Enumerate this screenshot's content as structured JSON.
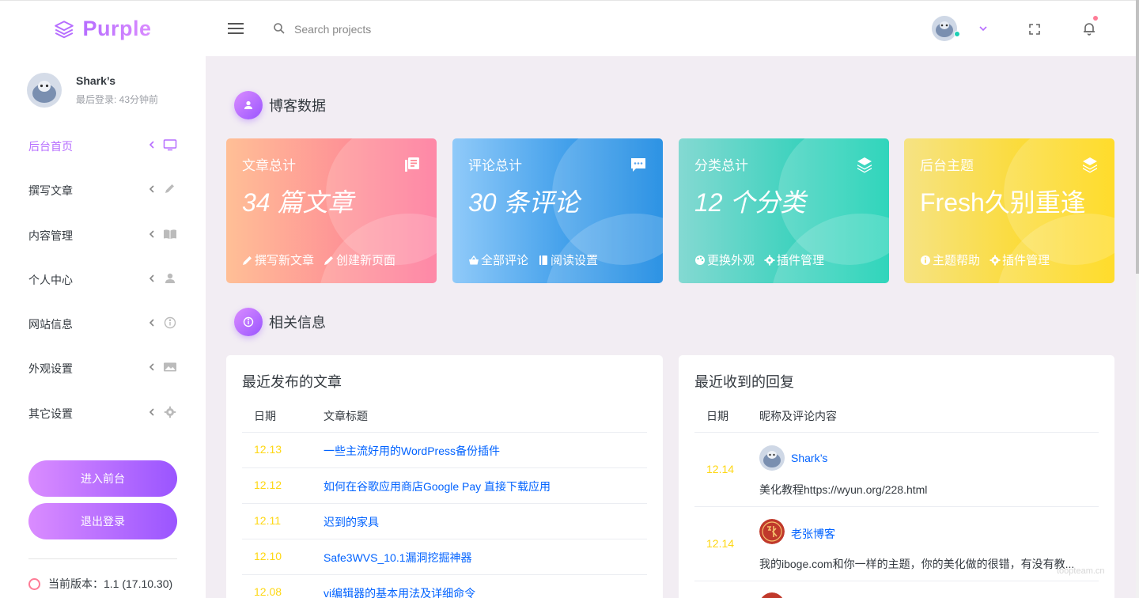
{
  "brand": {
    "name": "Purple"
  },
  "search": {
    "placeholder": "Search projects"
  },
  "profile": {
    "name": "Shark’s",
    "last_login": "最后登录: 43分钟前"
  },
  "nav": [
    {
      "label": "后台首页",
      "icon": "monitor-icon",
      "active": true
    },
    {
      "label": "撰写文章",
      "icon": "pencil-icon",
      "active": false
    },
    {
      "label": "内容管理",
      "icon": "book-open-icon",
      "active": false
    },
    {
      "label": "个人中心",
      "icon": "user-icon",
      "active": false
    },
    {
      "label": "网站信息",
      "icon": "info-icon",
      "active": false
    },
    {
      "label": "外观设置",
      "icon": "image-icon",
      "active": false
    },
    {
      "label": "其它设置",
      "icon": "gear-icon",
      "active": false
    }
  ],
  "buttons": {
    "front": "进入前台",
    "logout": "退出登录"
  },
  "version": "当前版本：1.1 (17.10.30)",
  "sections": {
    "blog_data": "博客数据",
    "related_info": "相关信息"
  },
  "cards": [
    {
      "title": "文章总计",
      "value": "34 篇文章",
      "icon": "library-icon",
      "links": [
        {
          "label": "撰写新文章",
          "icon": "pencil-icon"
        },
        {
          "label": "创建新页面",
          "icon": "pencil-icon"
        }
      ]
    },
    {
      "title": "评论总计",
      "value": "30 条评论",
      "icon": "message-icon",
      "links": [
        {
          "label": "全部评论",
          "icon": "basket-icon"
        },
        {
          "label": "阅读设置",
          "icon": "book-icon"
        }
      ]
    },
    {
      "title": "分类总计",
      "value": "12 个分类",
      "icon": "layers-icon",
      "links": [
        {
          "label": "更换外观",
          "icon": "palette-icon"
        },
        {
          "label": "插件管理",
          "icon": "gear-icon"
        }
      ]
    },
    {
      "title": "后台主题",
      "value": "Fresh久别重逢",
      "icon": "layers-icon",
      "links": [
        {
          "label": "主题帮助",
          "icon": "info-icon"
        },
        {
          "label": "插件管理",
          "icon": "gear-icon"
        }
      ]
    }
  ],
  "recent_posts": {
    "title": "最近发布的文章",
    "columns": [
      "日期",
      "文章标题"
    ],
    "rows": [
      {
        "date": "12.13",
        "title": "一些主流好用的WordPress备份插件"
      },
      {
        "date": "12.12",
        "title": "如何在谷歌应用商店Google Pay 直接下载应用"
      },
      {
        "date": "12.11",
        "title": "迟到的家具"
      },
      {
        "date": "12.10",
        "title": "Safe3WVS_10.1漏洞挖掘神器"
      },
      {
        "date": "12.08",
        "title": "vi编辑器的基本用法及详细命令"
      }
    ]
  },
  "recent_replies": {
    "title": "最近收到的回复",
    "columns": [
      "日期",
      "昵称及评论内容"
    ],
    "rows": [
      {
        "date": "12.14",
        "name": "Shark’s",
        "comment": "美化教程https://wyun.org/228.html"
      },
      {
        "date": "12.14",
        "name": "老张博客",
        "comment": "我的iboge.com和你一样的主题，你的美化做的很错，有没有教..."
      }
    ]
  },
  "watermark": "toopteam.cn",
  "colors": {
    "accent": "#b66dff",
    "date": "#fed713",
    "link": "#0062ff"
  }
}
